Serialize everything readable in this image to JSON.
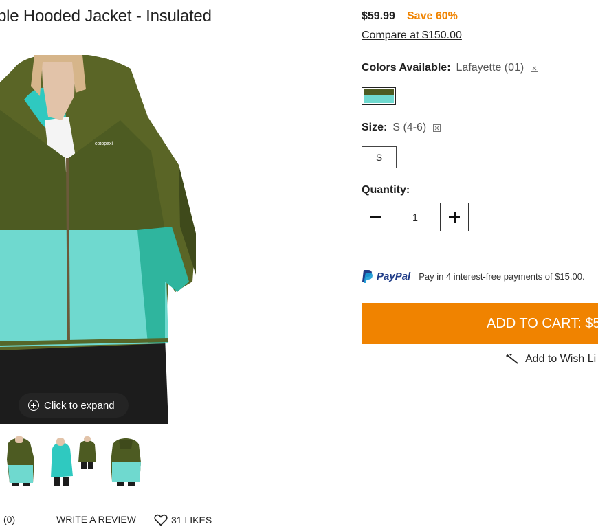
{
  "product": {
    "title": "ble Hooded Jacket - Insulated",
    "price": "$59.99",
    "save": "Save 60%",
    "compare": "Compare at $150.00"
  },
  "image": {
    "expand_label": "Click to expand"
  },
  "options": {
    "colors_label": "Colors Available:",
    "colors_value": "Lafayette (01)",
    "size_label": "Size:",
    "size_value": "S (4-6)",
    "size_option": "S",
    "quantity_label": "Quantity:",
    "quantity_value": "1"
  },
  "paypal": {
    "brand": "PayPal",
    "message": "Pay in 4 interest-free payments of $15.00."
  },
  "cart": {
    "button_label": "ADD TO CART: $59"
  },
  "wishlist": {
    "label": "Add to Wish Li"
  },
  "reviews": {
    "count": "(0)",
    "write_review": "WRITE A REVIEW",
    "likes": "31 LIKES"
  },
  "colors": {
    "accent": "#f08300",
    "jacket_olive": "#4d5b22",
    "jacket_teal": "#6fd9cf",
    "paypal_dark": "#1f3c88",
    "paypal_light": "#179bd7"
  }
}
